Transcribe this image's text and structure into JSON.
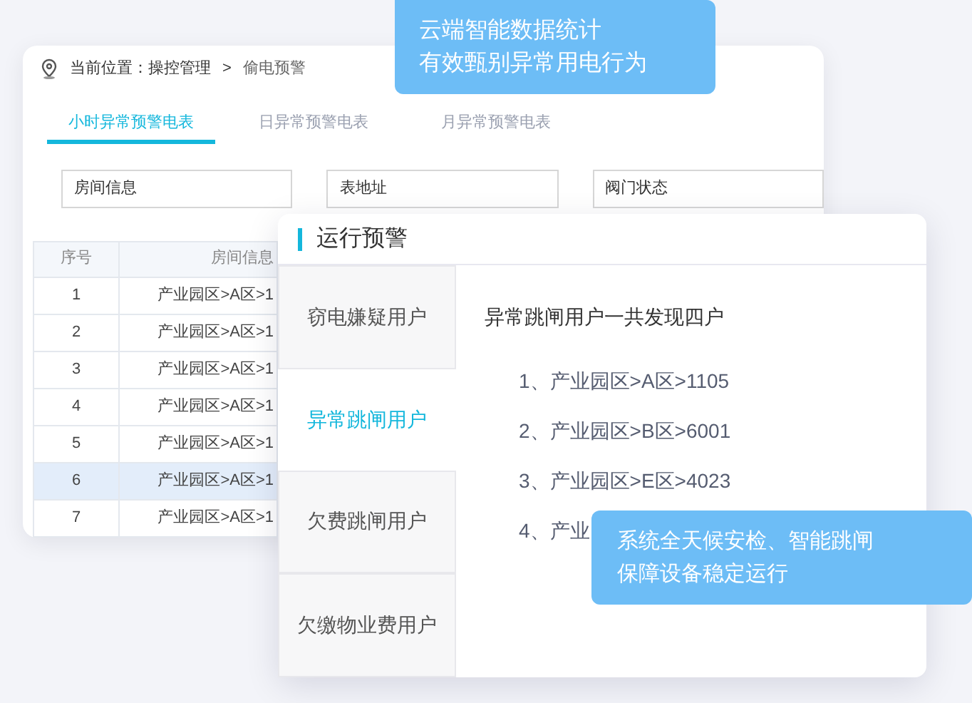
{
  "breadcrumb": {
    "label": "当前位置：操控管理",
    "separator": ">",
    "current": "偷电预警"
  },
  "tabs": [
    {
      "label": "小时异常预警电表",
      "selected": true
    },
    {
      "label": "日异常预警电表",
      "selected": false
    },
    {
      "label": "月异常预警电表",
      "selected": false
    }
  ],
  "filters": [
    {
      "placeholder": "房间信息"
    },
    {
      "placeholder": "表地址"
    },
    {
      "placeholder": "阀门状态"
    }
  ],
  "table": {
    "columns": [
      "序号",
      "房间信息"
    ],
    "rows": [
      {
        "cells": [
          "1",
          "产业园区>A区>1"
        ],
        "selected": false
      },
      {
        "cells": [
          "2",
          "产业园区>A区>1"
        ],
        "selected": false
      },
      {
        "cells": [
          "3",
          "产业园区>A区>1"
        ],
        "selected": false
      },
      {
        "cells": [
          "4",
          "产业园区>A区>1"
        ],
        "selected": false
      },
      {
        "cells": [
          "5",
          "产业园区>A区>1"
        ],
        "selected": false
      },
      {
        "cells": [
          "6",
          "产业园区>A区>1"
        ],
        "selected": true
      },
      {
        "cells": [
          "7",
          "产业园区>A区>1"
        ],
        "selected": false
      }
    ]
  },
  "panel": {
    "title": "运行预警",
    "categories": [
      {
        "label": "窃电嫌疑用户",
        "selected": false
      },
      {
        "label": "异常跳闸用户",
        "selected": true
      },
      {
        "label": "欠费跳闸用户",
        "selected": false
      },
      {
        "label": "欠缴物业费用户",
        "selected": false
      }
    ],
    "summary": "异常跳闸用户一共发现四户",
    "items": [
      "1、产业园区>A区>1105",
      "2、产业园区>B区>6001",
      "3、产业园区>E区>4023",
      "4、产业"
    ]
  },
  "callouts": [
    {
      "lines": [
        "云端智能数据统计",
        "有效甄别异常用电行为"
      ]
    },
    {
      "lines": [
        "系统全天候安检、智能跳闸",
        "保障设备稳定运行"
      ]
    }
  ]
}
